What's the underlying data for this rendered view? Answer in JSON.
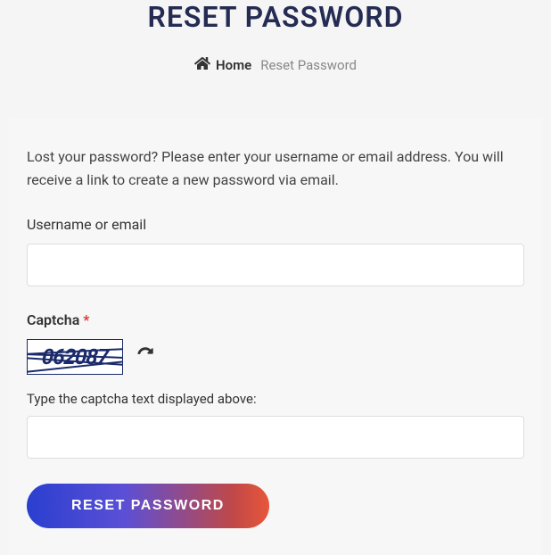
{
  "header": {
    "title": "RESET PASSWORD",
    "breadcrumb": {
      "home_label": "Home",
      "current_label": "Reset Password"
    }
  },
  "form": {
    "instruction": "Lost your password? Please enter your username or email address. You will receive a link to create a new password via email.",
    "username_label": "Username or email",
    "username_value": "",
    "captcha": {
      "label": "Captcha",
      "required_mark": "*",
      "code": "062087",
      "instruction": "Type the captcha text displayed above:",
      "input_value": ""
    },
    "submit_label": "RESET PASSWORD"
  }
}
